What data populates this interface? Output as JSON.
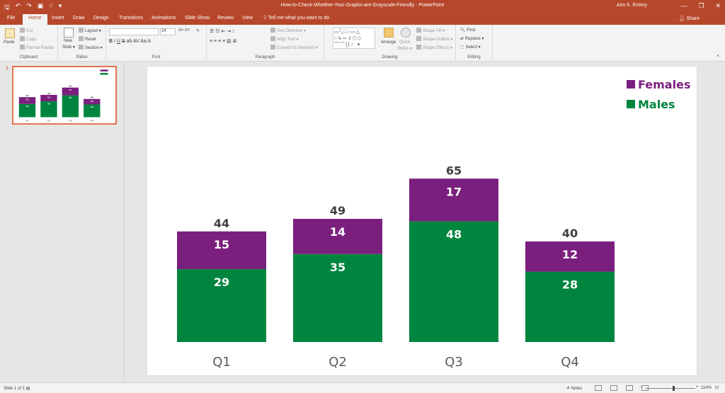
{
  "titlebar": {
    "document_title": "How-to-Check-Whether-Your-Graphs-are-Grayscale-Friendly - PowerPoint",
    "user_name": "Ann K. Emery",
    "qat_icons": [
      "save-icon",
      "undo-icon",
      "redo-icon",
      "start-slideshow-icon",
      "touch-mode-icon",
      "customize-qat-icon"
    ],
    "window_icons": [
      "minimize-icon",
      "restore-icon",
      "close-icon"
    ]
  },
  "tabs": [
    "File",
    "Home",
    "Insert",
    "Draw",
    "Design",
    "Transitions",
    "Animations",
    "Slide Show",
    "Review",
    "View"
  ],
  "active_tab": "Home",
  "tell_me": "Tell me what you want to do",
  "share_label": "Share",
  "ribbon": {
    "clipboard": {
      "paste": "Paste",
      "cut": "Cut",
      "copy": "Copy",
      "format_painter": "Format Painter",
      "label": "Clipboard"
    },
    "slides": {
      "new_slide": "New",
      "new_slide_2": "Slide ▾",
      "layout": "Layout ▾",
      "reset": "Reset",
      "section": "Section ▾",
      "label": "Slides"
    },
    "font": {
      "size": "24",
      "label": "Font"
    },
    "paragraph": {
      "text_direction": "Text Direction ▾",
      "align_text": "Align Text ▾",
      "convert_smartart": "Convert to SmartArt ▾",
      "label": "Paragraph"
    },
    "drawing": {
      "shapes_glyphs": "▭╲□○▭△ ⌐↳⇨⇩⬡◇ ⌒⌒{}☆ ▾",
      "arrange": "Arrange",
      "quick_styles": "Quick",
      "quick_styles_2": "Styles ▾",
      "shape_fill": "Shape Fill ▾",
      "shape_outline": "Shape Outline ▾",
      "shape_effects": "Shape Effects ▾",
      "label": "Drawing"
    },
    "editing": {
      "find": "Find",
      "replace": "Replace ▾",
      "select": "Select ▾",
      "label": "Editing"
    }
  },
  "thumbnail": {
    "slide_number": "1"
  },
  "status": {
    "slide_info": "Slide 1 of 1",
    "notes": "Notes",
    "zoom": "114%"
  },
  "colors": {
    "accent": "#b7472a",
    "females": "#7a1f7e",
    "males": "#00853f",
    "total_label": "#3f3f3f"
  },
  "chart_data": {
    "type": "bar",
    "stacked": true,
    "categories": [
      "Q1",
      "Q2",
      "Q3",
      "Q4"
    ],
    "series": [
      {
        "name": "Males",
        "values": [
          29,
          35,
          48,
          28
        ],
        "color": "#00853f"
      },
      {
        "name": "Females",
        "values": [
          15,
          14,
          17,
          12
        ],
        "color": "#7a1f7e"
      }
    ],
    "totals": [
      44,
      49,
      65,
      40
    ],
    "legend_order": [
      "Females",
      "Males"
    ],
    "legend_position": "top-right",
    "ylim": [
      0,
      65
    ],
    "grid": false,
    "title": "",
    "xlabel": "",
    "ylabel": ""
  }
}
